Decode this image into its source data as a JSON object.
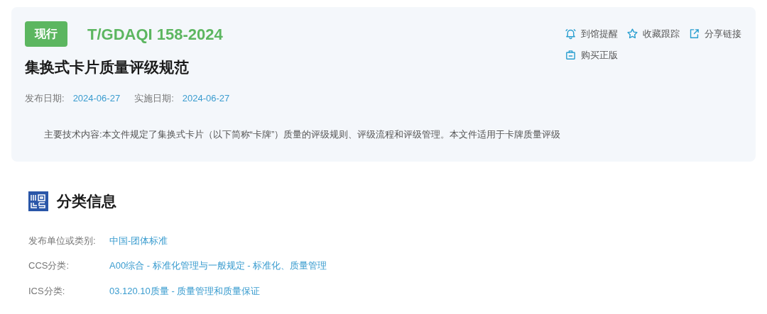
{
  "standard": {
    "status": {
      "label": "现行",
      "kind": "current"
    },
    "code": "T/GDAQI 158-2024",
    "title": "集换式卡片质量评级规范",
    "dates": [
      {
        "label": "发布日期:",
        "value": "2024-06-27"
      },
      {
        "label": "实施日期:",
        "value": "2024-06-27"
      }
    ],
    "summary": "主要技术内容:本文件规定了集换式卡片（以下简称“卡牌”）质量的评级规则、评级流程和评级管理。本文件适用于卡牌质量评级"
  },
  "actions": [
    {
      "label": "到馆提醒",
      "kind": "bell"
    },
    {
      "label": "收藏跟踪",
      "kind": "star"
    },
    {
      "label": "分享链接",
      "kind": "share"
    },
    {
      "label": "购买正版",
      "kind": "bag"
    }
  ],
  "classification": {
    "heading": "分类信息",
    "rows": [
      {
        "label": "发布单位或类别:",
        "value": "中国-团体标准"
      },
      {
        "label": "CCS分类:",
        "value": "A00综合 - 标准化管理与一般规定 - 标准化、质量管理"
      },
      {
        "label": "ICS分类:",
        "value": "03.120.10质量 - 质量管理和质量保证"
      }
    ]
  }
}
